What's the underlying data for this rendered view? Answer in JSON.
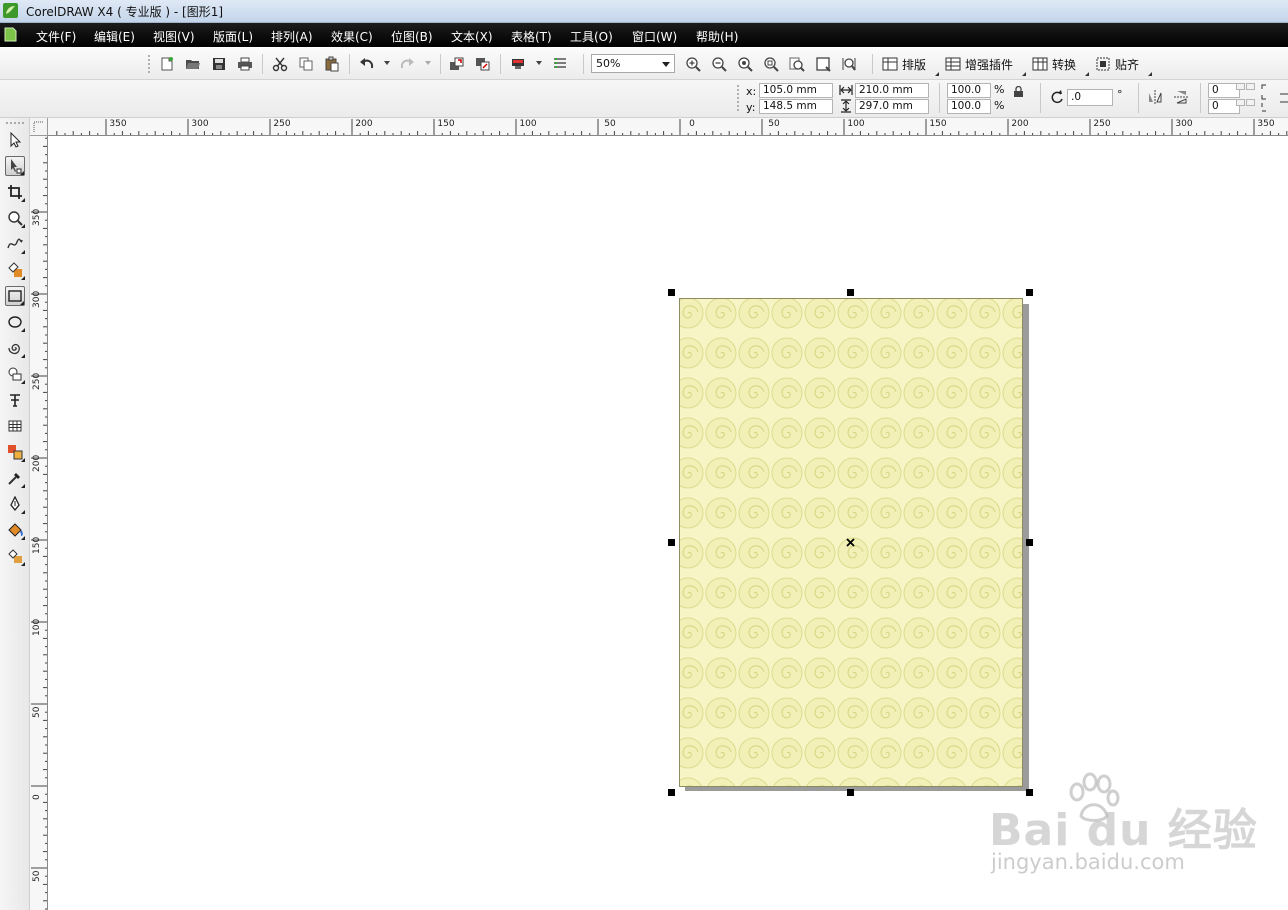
{
  "window": {
    "title": "CorelDRAW X4 ( 专业版 ) - [图形1]"
  },
  "menu": {
    "items": [
      "文件(F)",
      "编辑(E)",
      "视图(V)",
      "版面(L)",
      "排列(A)",
      "效果(C)",
      "位图(B)",
      "文本(X)",
      "表格(T)",
      "工具(O)",
      "窗口(W)",
      "帮助(H)"
    ]
  },
  "toolbar": {
    "zoom_value": "50%",
    "layout_label": "排版",
    "plugins_label": "增强插件",
    "convert_label": "转换",
    "snap_label": "贴齐"
  },
  "property_bar": {
    "x_label": "x:",
    "x_value": "105.0 mm",
    "y_label": "y:",
    "y_value": "148.5 mm",
    "width_value": "210.0 mm",
    "height_value": "297.0 mm",
    "scale_x": "100.0",
    "scale_y": "100.0",
    "percent_symbol": "%",
    "rotation_value": ".0",
    "degree_symbol": "°",
    "pos_a": "0",
    "pos_b": "0"
  },
  "rulers": {
    "horizontal_labels": [
      "350",
      "300",
      "250",
      "200",
      "150",
      "100",
      "50",
      "0",
      "50",
      "100",
      "150",
      "200",
      "250",
      "300",
      "350"
    ],
    "vertical_labels": [
      "350",
      "300",
      "250",
      "200",
      "150",
      "100",
      "50",
      "0",
      "50"
    ]
  },
  "watermark": {
    "main": "Bai du 经验",
    "sub": "jingyan.baidu.com"
  },
  "colors": {
    "page_fill": "#f7f5c6",
    "pattern_stroke": "#d9d98a",
    "menu_bg": "#000000",
    "title_bg": "#cfdcec"
  }
}
